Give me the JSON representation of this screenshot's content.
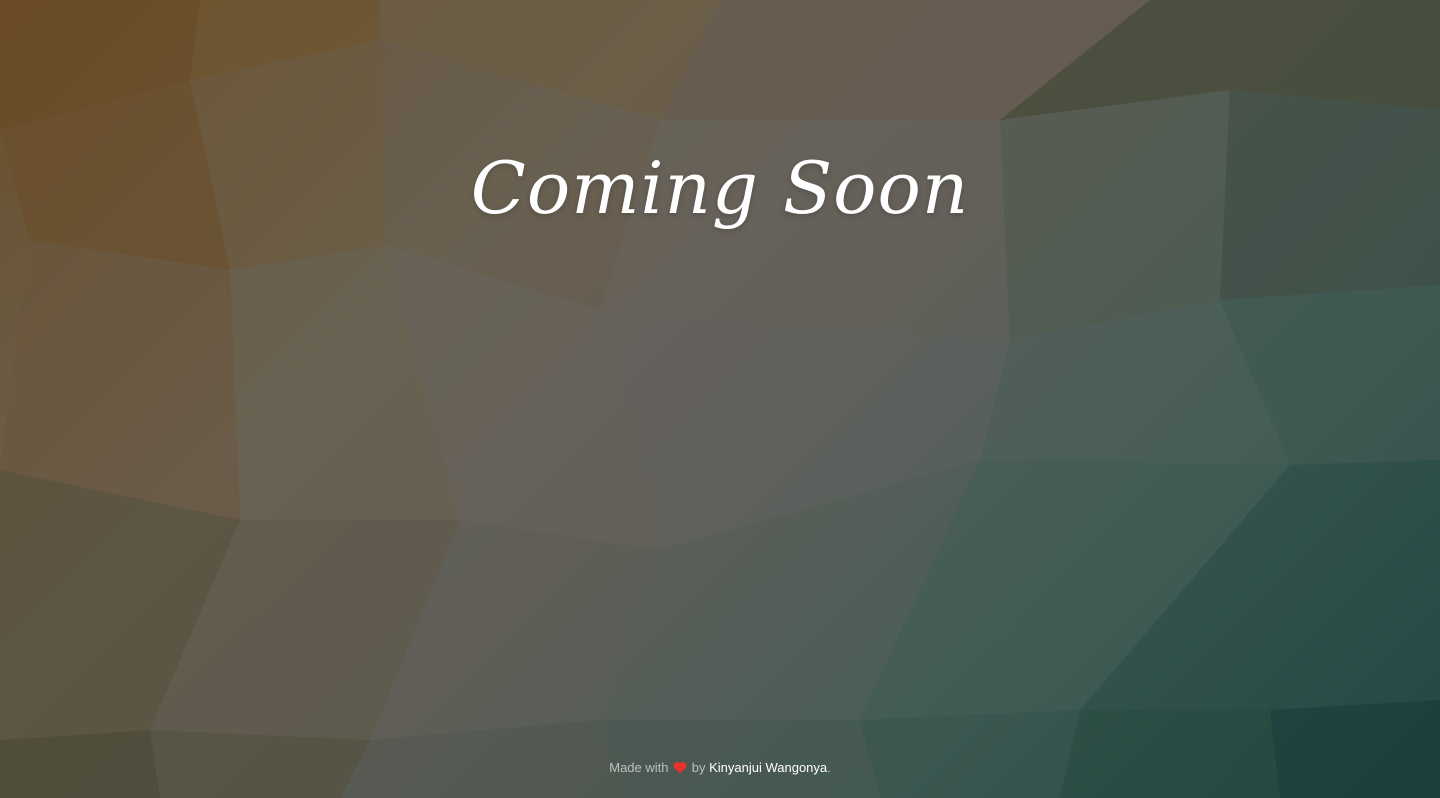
{
  "page": {
    "title": "Coming Soon"
  },
  "footer": {
    "prefix": "Made with",
    "heart_icon": "heart-icon",
    "heart_color": "#e8332d",
    "middle": "by",
    "author": "Kinyanjui Wangonya",
    "suffix": "."
  },
  "colors": {
    "title_text": "#ffffff",
    "author_text": "#ffffff"
  }
}
